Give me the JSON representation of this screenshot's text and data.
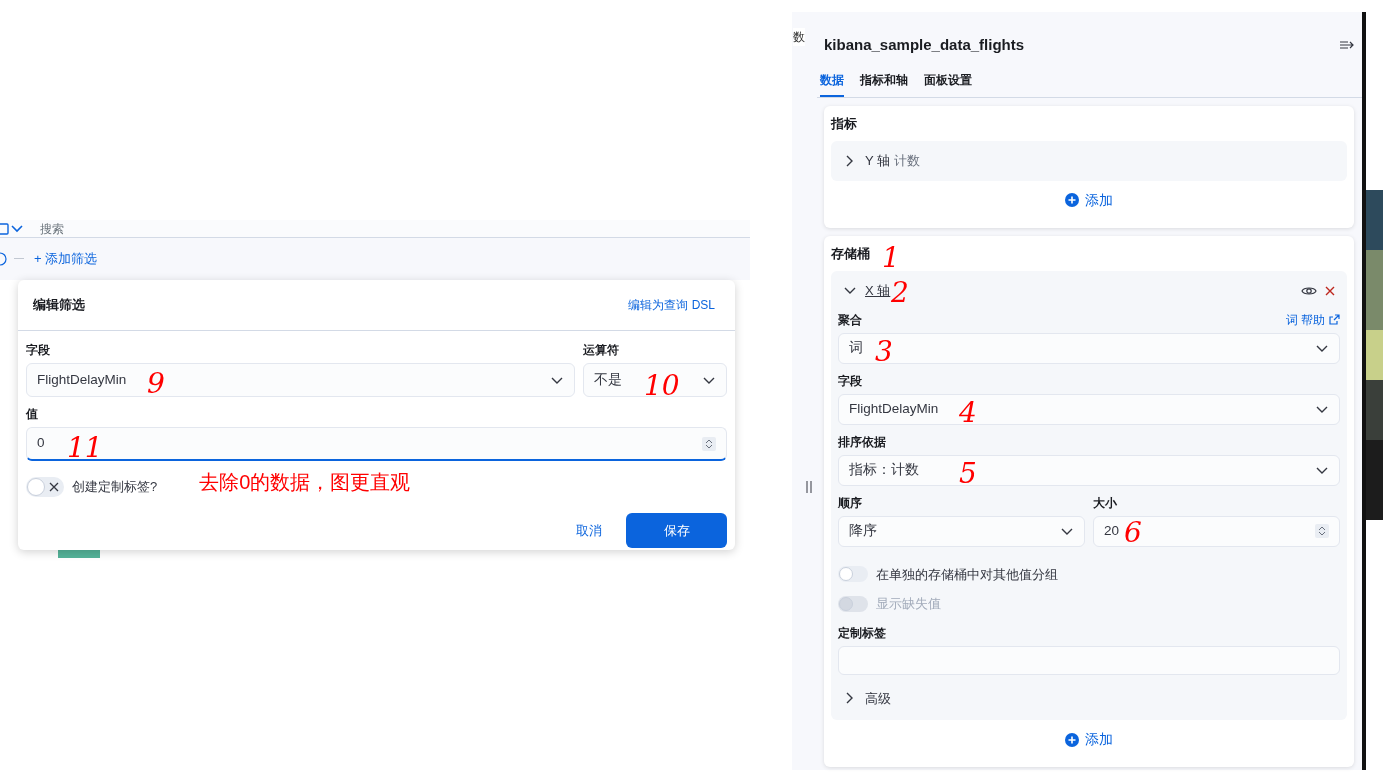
{
  "left_pane": {
    "search_placeholder": "搜索",
    "add_filter": "+ 添加筛选",
    "dialog": {
      "title": "编辑筛选",
      "dsl_link": "编辑为查询 DSL",
      "field": {
        "label": "字段",
        "value": "FlightDelayMin",
        "annotation": "9"
      },
      "operator": {
        "label": "运算符",
        "value": "不是",
        "annotation": "10"
      },
      "value": {
        "label": "值",
        "value": "0",
        "annotation": "11"
      },
      "custom_label_toggle": {
        "label": "创建定制标签?",
        "on": false
      },
      "note": "去除0的数据，图更直观",
      "cancel": "取消",
      "save": "保存"
    }
  },
  "right_pane": {
    "cut_text": "数",
    "title": "kibana_sample_data_flights",
    "tabs": [
      {
        "label": "数据",
        "selected": true
      },
      {
        "label": "指标和轴",
        "selected": false
      },
      {
        "label": "面板设置",
        "selected": false
      }
    ],
    "metrics": {
      "heading": "指标",
      "items": [
        {
          "axis": "Y 轴",
          "agg": "计数",
          "expanded": false
        }
      ],
      "add": "添加"
    },
    "buckets": {
      "heading": "存储桶",
      "annotation": "1",
      "item": {
        "axis": "X 轴",
        "annotation": "2",
        "expanded": true,
        "aggregation": {
          "label": "聚合",
          "help": "词 帮助",
          "value": "词",
          "annotation": "3"
        },
        "field": {
          "label": "字段",
          "value": "FlightDelayMin",
          "annotation": "4"
        },
        "order_by": {
          "label": "排序依据",
          "value": "指标：计数",
          "annotation": "5"
        },
        "order": {
          "label": "顺序",
          "value": "降序"
        },
        "size": {
          "label": "大小",
          "value": "20",
          "annotation": "6"
        },
        "switches": [
          {
            "label": "在单独的存储桶中对其他值分组",
            "on": false,
            "disabled": false
          },
          {
            "label": "显示缺失值",
            "on": false,
            "disabled": true
          }
        ],
        "custom_label": {
          "label": "定制标签"
        },
        "advanced": {
          "label": "高级",
          "expanded": false
        }
      },
      "add": "添加"
    }
  }
}
